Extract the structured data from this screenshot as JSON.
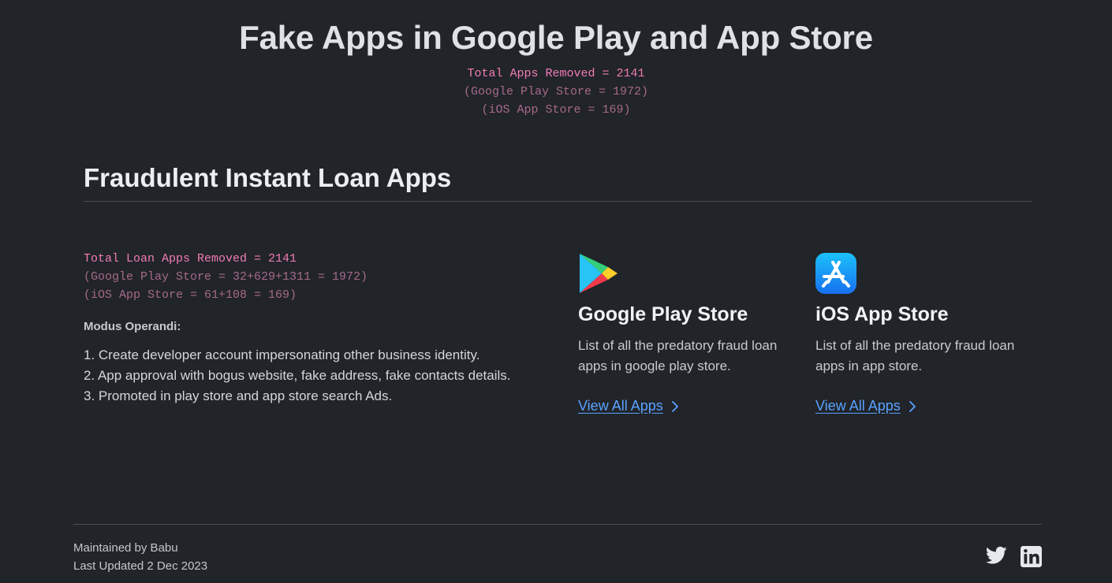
{
  "header": {
    "title": "Fake Apps in Google Play and App Store",
    "total_removed": "Total Apps Removed = 2141",
    "google_line": "(Google Play Store = 1972)",
    "ios_line": "(iOS App Store = 169)"
  },
  "section": {
    "title": "Fraudulent Instant Loan Apps",
    "total_loan": "Total Loan Apps Removed = 2141",
    "google_breakdown": "(Google Play Store = 32+629+1311 = 1972)",
    "ios_breakdown": "(iOS App Store = 61+108 = 169)",
    "modus_title": "Modus Operandi:",
    "steps": [
      "1. Create developer account impersonating other business identity.",
      "2. App approval with bogus website, fake address, fake contacts details.",
      "3. Promoted in play store and app store search Ads."
    ]
  },
  "stores": [
    {
      "name": "Google Play Store",
      "description": "List of all the predatory fraud loan apps in google play store.",
      "link_label": "View All Apps",
      "icon": "google-play-icon"
    },
    {
      "name": "iOS App Store",
      "description": "List of all the predatory fraud loan apps in app store.",
      "link_label": "View All Apps",
      "icon": "app-store-icon"
    }
  ],
  "footer": {
    "maintained": "Maintained by Babu",
    "updated": "Last Updated 2 Dec 2023",
    "social_icons": [
      "twitter-icon",
      "linkedin-icon"
    ]
  },
  "colors": {
    "background": "#212429",
    "accent_link": "#5aa2ff",
    "stat_pink": "#f07cb4",
    "stat_muted": "#a76a8a"
  }
}
